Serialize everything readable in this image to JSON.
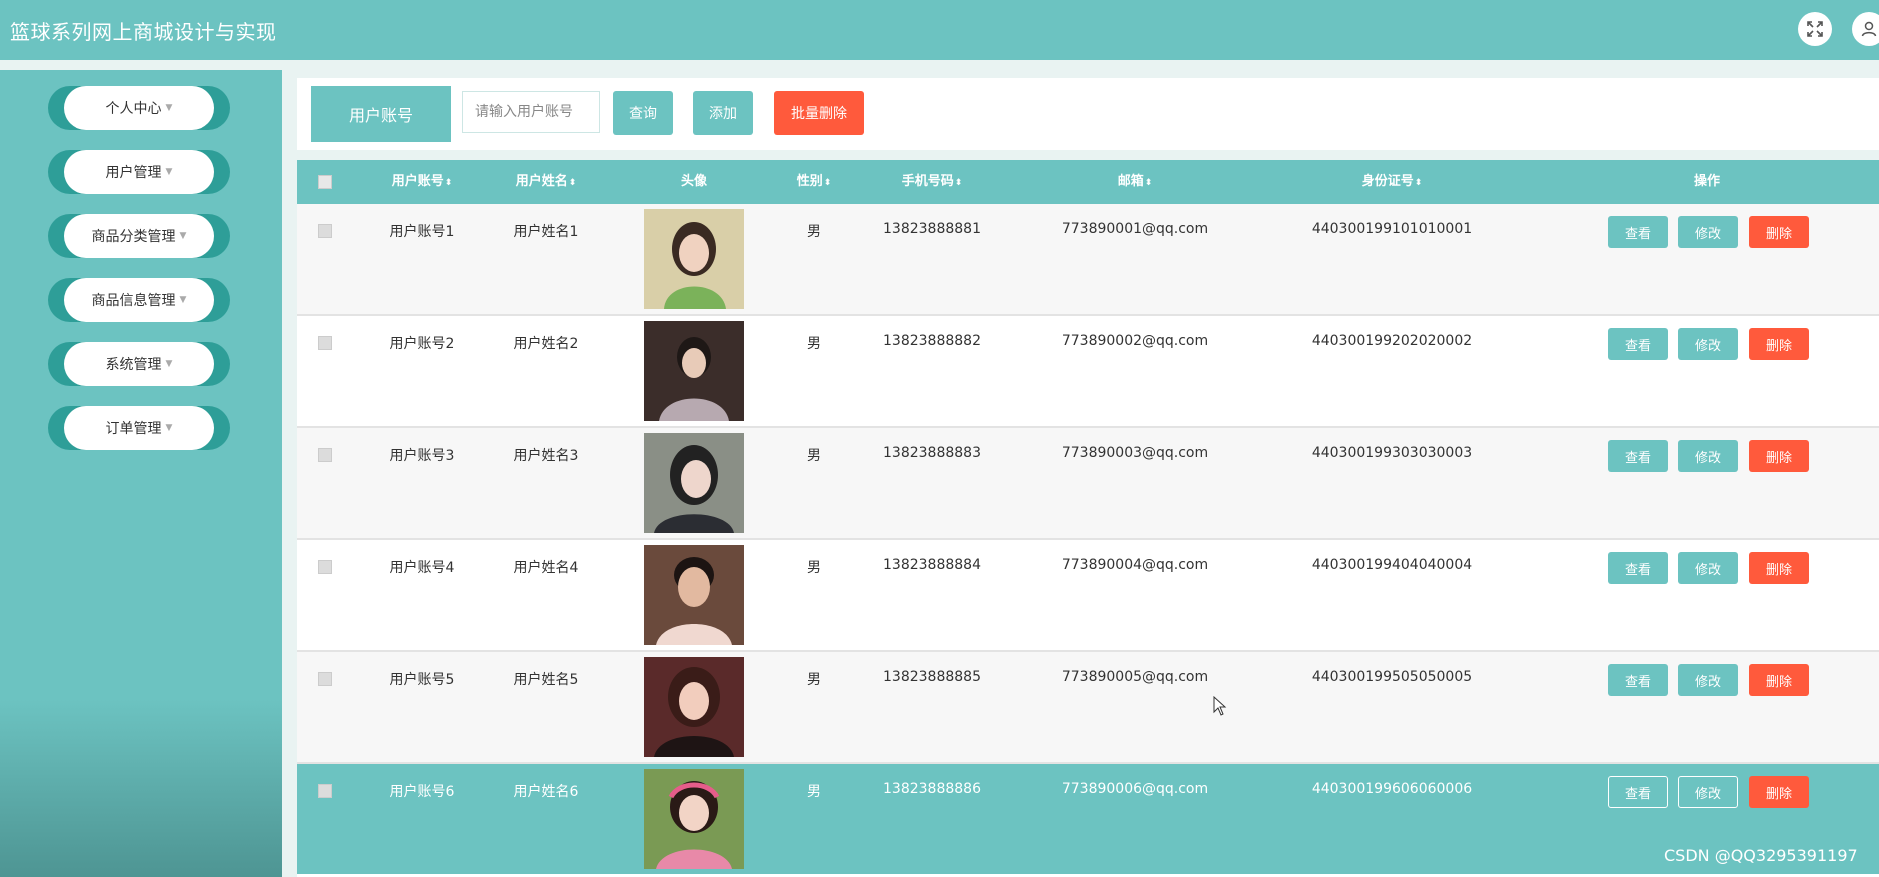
{
  "app": {
    "title": "篮球系列网上商城设计与实现"
  },
  "header_icons": {
    "fullscreen": "fullscreen-icon",
    "user": "user-icon"
  },
  "sidebar": {
    "items": [
      {
        "label": "个人中心"
      },
      {
        "label": "用户管理"
      },
      {
        "label": "商品分类管理"
      },
      {
        "label": "商品信息管理"
      },
      {
        "label": "系统管理"
      },
      {
        "label": "订单管理"
      }
    ]
  },
  "search": {
    "label": "用户账号",
    "placeholder": "请输入用户账号",
    "query_btn": "查询",
    "add_btn": "添加",
    "batch_delete_btn": "批量删除"
  },
  "table": {
    "headers": {
      "account": "用户账号",
      "name": "用户姓名",
      "avatar": "头像",
      "gender": "性别",
      "phone": "手机号码",
      "email": "邮箱",
      "idcard": "身份证号",
      "actions": "操作"
    },
    "sort_glyph": "⬍",
    "rows": [
      {
        "account": "用户账号1",
        "name": "用户姓名1",
        "gender": "男",
        "phone": "13823888881",
        "email": "773890001@qq.com",
        "idcard": "440300199101010001"
      },
      {
        "account": "用户账号2",
        "name": "用户姓名2",
        "gender": "男",
        "phone": "13823888882",
        "email": "773890002@qq.com",
        "idcard": "440300199202020002"
      },
      {
        "account": "用户账号3",
        "name": "用户姓名3",
        "gender": "男",
        "phone": "13823888883",
        "email": "773890003@qq.com",
        "idcard": "440300199303030003"
      },
      {
        "account": "用户账号4",
        "name": "用户姓名4",
        "gender": "男",
        "phone": "13823888884",
        "email": "773890004@qq.com",
        "idcard": "440300199404040004"
      },
      {
        "account": "用户账号5",
        "name": "用户姓名5",
        "gender": "男",
        "phone": "13823888885",
        "email": "773890005@qq.com",
        "idcard": "440300199505050005"
      },
      {
        "account": "用户账号6",
        "name": "用户姓名6",
        "gender": "男",
        "phone": "13823888886",
        "email": "773890006@qq.com",
        "idcard": "440300199606060006"
      }
    ],
    "actions": {
      "view": "查看",
      "edit": "修改",
      "delete": "删除"
    }
  },
  "watermark": "CSDN @QQ3295391197",
  "colors": {
    "primary": "#6cc3c1",
    "danger": "#ff5a3c",
    "sidebar_pill_edge": "#2e9e98"
  }
}
